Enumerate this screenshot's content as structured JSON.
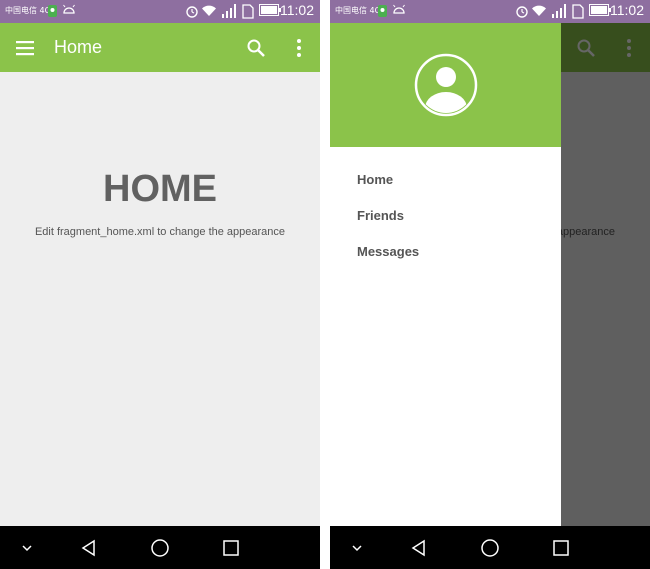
{
  "status_bar": {
    "carrier": "中国电信 4G",
    "time": "11:02"
  },
  "toolbar": {
    "title": "Home"
  },
  "home": {
    "heading": "HOME",
    "description": "Edit fragment_home.xml to change the appearance"
  },
  "drawer": {
    "items": [
      {
        "label": "Home"
      },
      {
        "label": "Friends"
      },
      {
        "label": "Messages"
      }
    ]
  },
  "icons": {
    "menu": "hamburger-menu-icon",
    "search": "search-icon",
    "more": "more-vert-icon",
    "avatar": "account-circle-icon",
    "nav_down": "chevron-down-icon",
    "nav_back": "back-triangle-icon",
    "nav_home": "home-circle-icon",
    "nav_recents": "recents-square-icon"
  },
  "colors": {
    "status_bar": "#8e6fa0",
    "app_bar": "#8bc34a",
    "background": "#eeeeee",
    "text_dark": "#616161",
    "nav_bar": "#000000"
  }
}
